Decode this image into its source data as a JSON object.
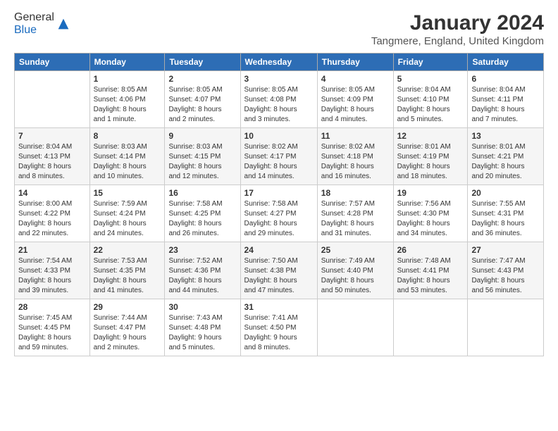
{
  "header": {
    "logo_general": "General",
    "logo_blue": "Blue",
    "main_title": "January 2024",
    "subtitle": "Tangmere, England, United Kingdom"
  },
  "days_of_week": [
    "Sunday",
    "Monday",
    "Tuesday",
    "Wednesday",
    "Thursday",
    "Friday",
    "Saturday"
  ],
  "weeks": [
    [
      {
        "day": "",
        "info": ""
      },
      {
        "day": "1",
        "info": "Sunrise: 8:05 AM\nSunset: 4:06 PM\nDaylight: 8 hours\nand 1 minute."
      },
      {
        "day": "2",
        "info": "Sunrise: 8:05 AM\nSunset: 4:07 PM\nDaylight: 8 hours\nand 2 minutes."
      },
      {
        "day": "3",
        "info": "Sunrise: 8:05 AM\nSunset: 4:08 PM\nDaylight: 8 hours\nand 3 minutes."
      },
      {
        "day": "4",
        "info": "Sunrise: 8:05 AM\nSunset: 4:09 PM\nDaylight: 8 hours\nand 4 minutes."
      },
      {
        "day": "5",
        "info": "Sunrise: 8:04 AM\nSunset: 4:10 PM\nDaylight: 8 hours\nand 5 minutes."
      },
      {
        "day": "6",
        "info": "Sunrise: 8:04 AM\nSunset: 4:11 PM\nDaylight: 8 hours\nand 7 minutes."
      }
    ],
    [
      {
        "day": "7",
        "info": "Sunrise: 8:04 AM\nSunset: 4:13 PM\nDaylight: 8 hours\nand 8 minutes."
      },
      {
        "day": "8",
        "info": "Sunrise: 8:03 AM\nSunset: 4:14 PM\nDaylight: 8 hours\nand 10 minutes."
      },
      {
        "day": "9",
        "info": "Sunrise: 8:03 AM\nSunset: 4:15 PM\nDaylight: 8 hours\nand 12 minutes."
      },
      {
        "day": "10",
        "info": "Sunrise: 8:02 AM\nSunset: 4:17 PM\nDaylight: 8 hours\nand 14 minutes."
      },
      {
        "day": "11",
        "info": "Sunrise: 8:02 AM\nSunset: 4:18 PM\nDaylight: 8 hours\nand 16 minutes."
      },
      {
        "day": "12",
        "info": "Sunrise: 8:01 AM\nSunset: 4:19 PM\nDaylight: 8 hours\nand 18 minutes."
      },
      {
        "day": "13",
        "info": "Sunrise: 8:01 AM\nSunset: 4:21 PM\nDaylight: 8 hours\nand 20 minutes."
      }
    ],
    [
      {
        "day": "14",
        "info": "Sunrise: 8:00 AM\nSunset: 4:22 PM\nDaylight: 8 hours\nand 22 minutes."
      },
      {
        "day": "15",
        "info": "Sunrise: 7:59 AM\nSunset: 4:24 PM\nDaylight: 8 hours\nand 24 minutes."
      },
      {
        "day": "16",
        "info": "Sunrise: 7:58 AM\nSunset: 4:25 PM\nDaylight: 8 hours\nand 26 minutes."
      },
      {
        "day": "17",
        "info": "Sunrise: 7:58 AM\nSunset: 4:27 PM\nDaylight: 8 hours\nand 29 minutes."
      },
      {
        "day": "18",
        "info": "Sunrise: 7:57 AM\nSunset: 4:28 PM\nDaylight: 8 hours\nand 31 minutes."
      },
      {
        "day": "19",
        "info": "Sunrise: 7:56 AM\nSunset: 4:30 PM\nDaylight: 8 hours\nand 34 minutes."
      },
      {
        "day": "20",
        "info": "Sunrise: 7:55 AM\nSunset: 4:31 PM\nDaylight: 8 hours\nand 36 minutes."
      }
    ],
    [
      {
        "day": "21",
        "info": "Sunrise: 7:54 AM\nSunset: 4:33 PM\nDaylight: 8 hours\nand 39 minutes."
      },
      {
        "day": "22",
        "info": "Sunrise: 7:53 AM\nSunset: 4:35 PM\nDaylight: 8 hours\nand 41 minutes."
      },
      {
        "day": "23",
        "info": "Sunrise: 7:52 AM\nSunset: 4:36 PM\nDaylight: 8 hours\nand 44 minutes."
      },
      {
        "day": "24",
        "info": "Sunrise: 7:50 AM\nSunset: 4:38 PM\nDaylight: 8 hours\nand 47 minutes."
      },
      {
        "day": "25",
        "info": "Sunrise: 7:49 AM\nSunset: 4:40 PM\nDaylight: 8 hours\nand 50 minutes."
      },
      {
        "day": "26",
        "info": "Sunrise: 7:48 AM\nSunset: 4:41 PM\nDaylight: 8 hours\nand 53 minutes."
      },
      {
        "day": "27",
        "info": "Sunrise: 7:47 AM\nSunset: 4:43 PM\nDaylight: 8 hours\nand 56 minutes."
      }
    ],
    [
      {
        "day": "28",
        "info": "Sunrise: 7:45 AM\nSunset: 4:45 PM\nDaylight: 8 hours\nand 59 minutes."
      },
      {
        "day": "29",
        "info": "Sunrise: 7:44 AM\nSunset: 4:47 PM\nDaylight: 9 hours\nand 2 minutes."
      },
      {
        "day": "30",
        "info": "Sunrise: 7:43 AM\nSunset: 4:48 PM\nDaylight: 9 hours\nand 5 minutes."
      },
      {
        "day": "31",
        "info": "Sunrise: 7:41 AM\nSunset: 4:50 PM\nDaylight: 9 hours\nand 8 minutes."
      },
      {
        "day": "",
        "info": ""
      },
      {
        "day": "",
        "info": ""
      },
      {
        "day": "",
        "info": ""
      }
    ]
  ]
}
